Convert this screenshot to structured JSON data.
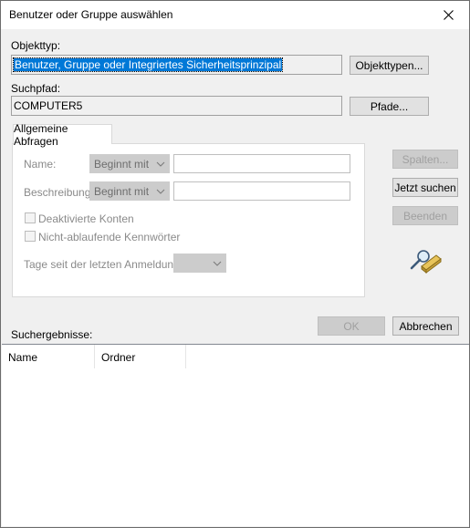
{
  "window": {
    "title": "Benutzer oder Gruppe auswählen"
  },
  "objekttyp": {
    "label": "Objekttyp:",
    "value": "Benutzer, Gruppe oder Integriertes Sicherheitsprinzipal",
    "button": "Objekttypen..."
  },
  "suchpfad": {
    "label": "Suchpfad:",
    "value": "COMPUTER5",
    "button": "Pfade..."
  },
  "tab": {
    "label": "Allgemeine Abfragen"
  },
  "query": {
    "name_label": "Name:",
    "name_mode": "Beginnt mit",
    "desc_label": "Beschreibung:",
    "desc_mode": "Beginnt mit",
    "check_disabled": "Deaktivierte Konten",
    "check_nonexpiring": "Nicht-ablaufende Kennwörter",
    "days_label": "Tage seit der letzten Anmeldung:"
  },
  "side_buttons": {
    "columns": "Spalten...",
    "search_now": "Jetzt suchen",
    "stop": "Beenden"
  },
  "dialog_buttons": {
    "ok": "OK",
    "cancel": "Abbrechen"
  },
  "results": {
    "label": "Suchergebnisse:",
    "columns": [
      "Name",
      "Ordner"
    ]
  },
  "icons": {
    "close": "close-icon",
    "find": "search-magnifier-icon",
    "dropdown": "chevron-down-icon"
  }
}
